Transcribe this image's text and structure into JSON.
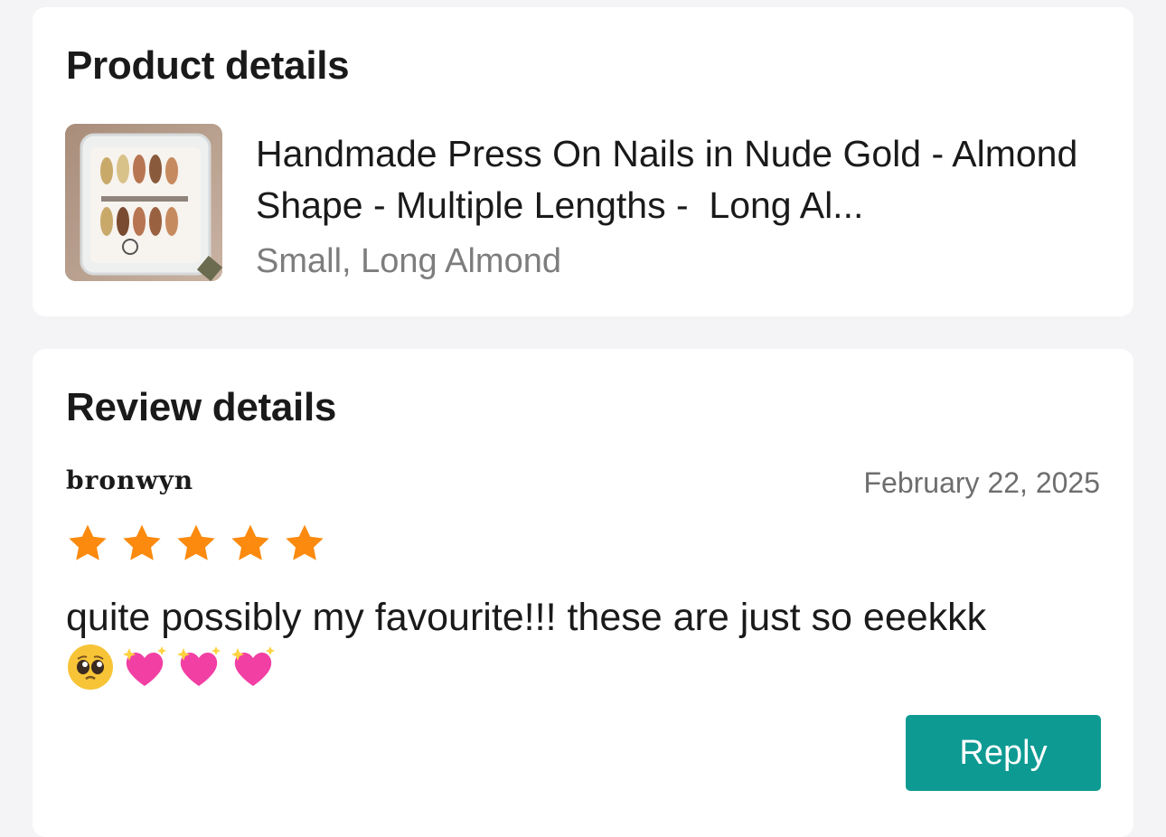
{
  "product_details": {
    "title": "Product details",
    "product": {
      "name": "Handmade Press On Nails in Nude Gold - Almond Shape - Multiple Lengths -  Long Al...",
      "variant": "Small, Long Almond",
      "thumbnail_icon": "nail-set-product-image"
    }
  },
  "review_details": {
    "title": "Review details",
    "reviewer_name": "bronwyn",
    "date": "February 22, 2025",
    "rating": 5,
    "rating_max": 5,
    "star_color": "#fb8a0e",
    "text": "quite possibly my favourite!!! these are just so eeekkk",
    "emojis": [
      "pleading-face-icon",
      "sparkling-heart-icon",
      "sparkling-heart-icon",
      "sparkling-heart-icon"
    ],
    "reply_label": "Reply",
    "reply_color": "#0d9a93"
  }
}
